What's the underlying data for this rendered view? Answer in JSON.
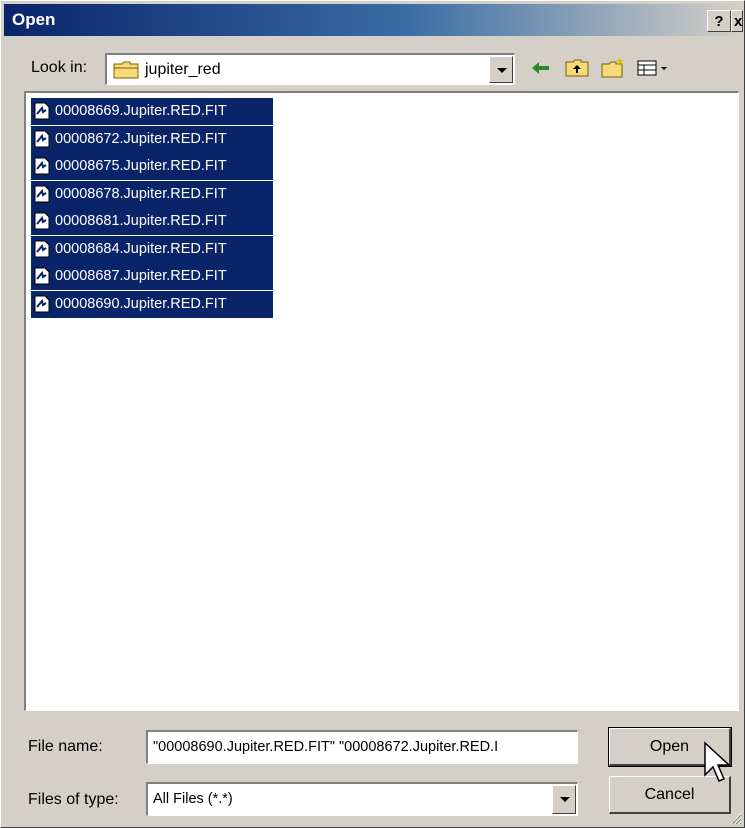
{
  "window": {
    "title": "Open",
    "help_label": "?",
    "close_label": "x"
  },
  "toolbar": {
    "look_in_label": "Look in:",
    "look_in_value": "jupiter_red",
    "icons": [
      "folder-icon",
      "back-icon",
      "up-folder-icon",
      "new-folder-icon",
      "views-menu-icon"
    ]
  },
  "files": [
    {
      "name": "00008669.Jupiter.RED.FIT",
      "selected": true
    },
    {
      "name": "00008672.Jupiter.RED.FIT",
      "selected": true
    },
    {
      "name": "00008675.Jupiter.RED.FIT",
      "selected": true
    },
    {
      "name": "00008678.Jupiter.RED.FIT",
      "selected": true
    },
    {
      "name": "00008681.Jupiter.RED.FIT",
      "selected": true
    },
    {
      "name": "00008684.Jupiter.RED.FIT",
      "selected": true
    },
    {
      "name": "00008687.Jupiter.RED.FIT",
      "selected": true
    },
    {
      "name": "00008690.Jupiter.RED.FIT",
      "selected": true
    }
  ],
  "form": {
    "file_name_label": "File name:",
    "file_name_value": "\"00008690.Jupiter.RED.FIT\" \"00008672.Jupiter.RED.I",
    "file_type_label": "Files of type:",
    "file_type_value": "All Files (*.*)"
  },
  "buttons": {
    "open": "Open",
    "cancel": "Cancel"
  },
  "colors": {
    "selection": "#0a246a",
    "title_start": "#0a246a",
    "face": "#d4d0c8"
  }
}
